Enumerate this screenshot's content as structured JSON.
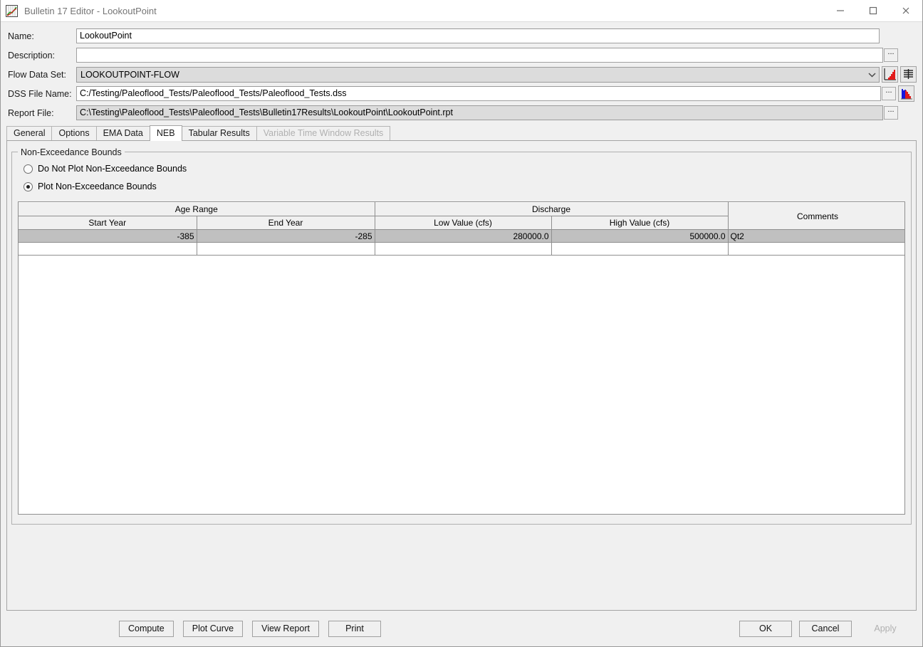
{
  "window": {
    "title": "Bulletin 17 Editor - LookoutPoint",
    "app_icon": "chart-grid-icon",
    "controls": {
      "minimize": "minimize-icon",
      "maximize": "maximize-icon",
      "close": "close-icon"
    }
  },
  "form": {
    "name": {
      "label": "Name:",
      "value": "LookoutPoint",
      "placeholder": ""
    },
    "description": {
      "label": "Description:",
      "value": "",
      "placeholder": "",
      "browse_label": "..."
    },
    "flow_data_set": {
      "label": "Flow Data Set:",
      "value": "LOOKOUTPOINT-FLOW",
      "chevron": "chevron-down-icon",
      "plot_icon": "red-bar-chart-icon",
      "table_icon": "table-icon"
    },
    "dss_file_name": {
      "label": "DSS File Name:",
      "value": "C:/Testing/Paleoflood_Tests/Paleoflood_Tests/Paleoflood_Tests.dss",
      "browse_label": "...",
      "histogram_icon": "blue-red-histogram-icon"
    },
    "report_file": {
      "label": "Report File:",
      "value": "C:\\Testing\\Paleoflood_Tests\\Paleoflood_Tests\\Bulletin17Results\\LookoutPoint\\LookoutPoint.rpt",
      "browse_label": "..."
    }
  },
  "tabs": [
    {
      "label": "General",
      "selected": false,
      "enabled": true
    },
    {
      "label": "Options",
      "selected": false,
      "enabled": true
    },
    {
      "label": "EMA Data",
      "selected": false,
      "enabled": true
    },
    {
      "label": "NEB",
      "selected": true,
      "enabled": true
    },
    {
      "label": "Tabular Results",
      "selected": false,
      "enabled": true
    },
    {
      "label": "Variable Time Window Results",
      "selected": false,
      "enabled": false
    }
  ],
  "neb_panel": {
    "group_title": "Non-Exceedance Bounds",
    "radios": [
      {
        "label": "Do Not Plot Non-Exceedance Bounds",
        "checked": false
      },
      {
        "label": "Plot Non-Exceedance Bounds",
        "checked": true
      }
    ],
    "table": {
      "group_headers": [
        {
          "label": "Age Range",
          "span": 2
        },
        {
          "label": "Discharge",
          "span": 2
        },
        {
          "label": "Comments",
          "span": 1,
          "rowspan": 2
        }
      ],
      "columns": [
        "Start Year",
        "End Year",
        "Low Value (cfs)",
        "High Value (cfs)",
        "Comments"
      ],
      "rows": [
        {
          "selected": true,
          "start_year": "-385",
          "end_year": "-285",
          "low_value": "280000.0",
          "high_value": "500000.0",
          "comments": "Qt2"
        },
        {
          "selected": false,
          "start_year": "",
          "end_year": "",
          "low_value": "",
          "high_value": "",
          "comments": ""
        }
      ]
    }
  },
  "bottom_buttons": {
    "left": [
      {
        "label": "Compute",
        "enabled": true
      },
      {
        "label": "Plot Curve",
        "enabled": true
      },
      {
        "label": "View Report",
        "enabled": true
      },
      {
        "label": "Print",
        "enabled": true
      }
    ],
    "right": [
      {
        "label": "OK",
        "enabled": true
      },
      {
        "label": "Cancel",
        "enabled": true
      },
      {
        "label": "Apply",
        "enabled": false
      }
    ]
  },
  "colors": {
    "window_bg": "#f0f0f0",
    "field_bg": "#ffffff",
    "readonly_bg": "#dcdcdc",
    "selection_bg": "#c0c0c0",
    "title_text": "#757575",
    "disabled_text": "#b0b0b0",
    "accent_red": "#e00000",
    "accent_blue": "#0000e0",
    "accent_green": "#008000"
  }
}
